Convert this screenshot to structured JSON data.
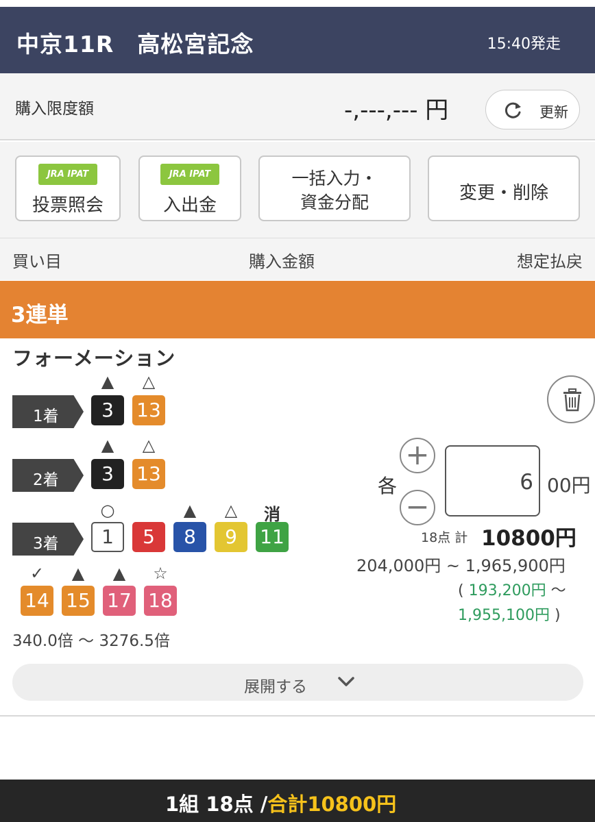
{
  "header": {
    "title": "中京11R　高松宮記念",
    "start_time": "15:40発走"
  },
  "limit": {
    "label": "購入限度額",
    "amount": "-,---,--- 円",
    "refresh_label": "更新",
    "refresh_icon": "refresh-icon"
  },
  "buttons": {
    "badge": "JRA IPAT",
    "inquiry_label": "投票照会",
    "deposit_label": "入出金",
    "bulk_line1": "一括入力・",
    "bulk_line2": "資金分配",
    "modify_label": "変更・削除"
  },
  "columns": {
    "bet": "買い目",
    "amount": "購入金額",
    "payout": "想定払戻"
  },
  "bet_type": "3連単",
  "formation_label": "フォーメーション",
  "positions": [
    "1着",
    "2着",
    "3着"
  ],
  "first": [
    {
      "num": "3",
      "mark": "▲",
      "color": "#222222"
    },
    {
      "num": "13",
      "mark": "△",
      "color": "#e48b2b"
    }
  ],
  "second": [
    {
      "num": "3",
      "mark": "▲",
      "color": "#222222"
    },
    {
      "num": "13",
      "mark": "△",
      "color": "#e48b2b"
    }
  ],
  "third": [
    {
      "num": "1",
      "mark": "○",
      "color": "#ffffff"
    },
    {
      "num": "5",
      "mark": "",
      "color": "#d93838"
    },
    {
      "num": "8",
      "mark": "▲",
      "color": "#2853a8"
    },
    {
      "num": "9",
      "mark": "△",
      "color": "#e3c632"
    },
    {
      "num": "11",
      "mark": "消",
      "color": "#3fa344"
    },
    {
      "num": "14",
      "mark": "✓",
      "color": "#e48b2b"
    },
    {
      "num": "15",
      "mark": "▲",
      "color": "#e48b2b"
    },
    {
      "num": "17",
      "mark": "▲",
      "color": "#e0607a"
    },
    {
      "num": "18",
      "mark": "☆",
      "color": "#e0607a"
    }
  ],
  "amount": {
    "each_label": "各",
    "value": "6",
    "unit": "00円",
    "points_label": "18点 計",
    "total": "10800円",
    "payout_range": "204,000円 ~ 1,965,900円",
    "profit_open": "(",
    "profit_low": "193,200円",
    "profit_sep": "～",
    "profit_high": "1,955,100円",
    "profit_close": ")"
  },
  "odds": "340.0倍 ～ 3276.5倍",
  "expand_label": "展開する",
  "footer": {
    "summary": "1組 18点 /",
    "total": "合計10800円"
  }
}
